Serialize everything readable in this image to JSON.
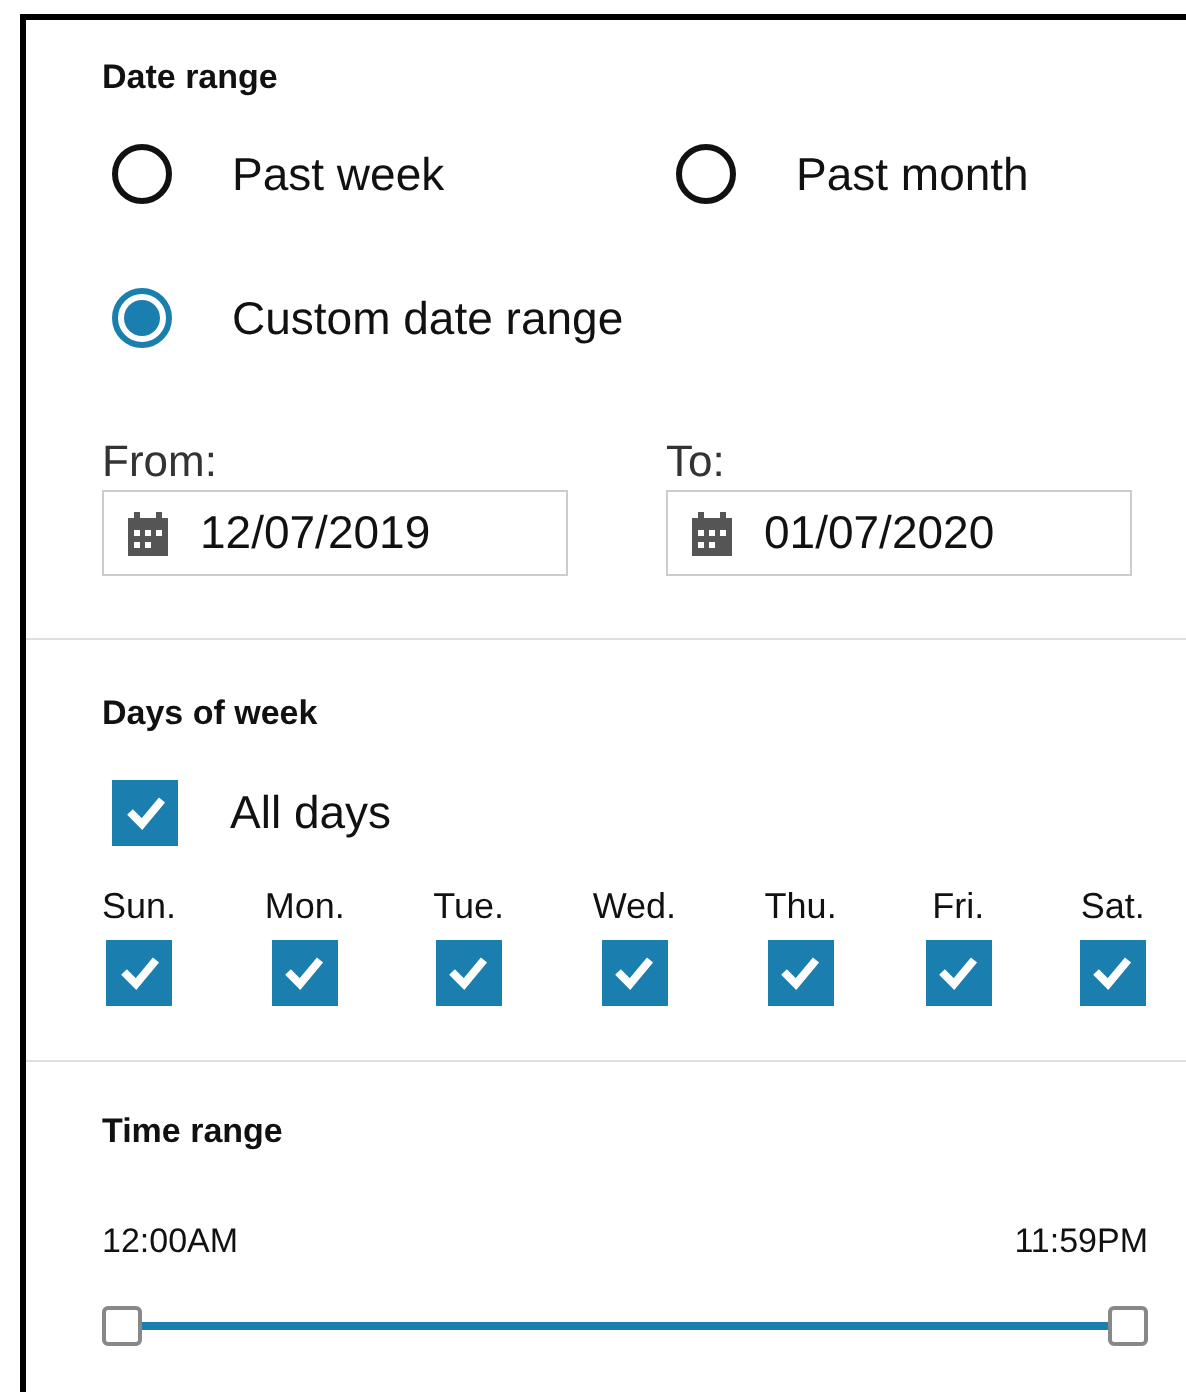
{
  "date_range": {
    "heading": "Date range",
    "options": [
      {
        "label": "Past week",
        "selected": false
      },
      {
        "label": "Past month",
        "selected": false
      },
      {
        "label": "Custom date range",
        "selected": true
      }
    ],
    "from": {
      "label": "From:",
      "value": "12/07/2019"
    },
    "to": {
      "label": "To:",
      "value": "01/07/2020"
    }
  },
  "days_of_week": {
    "heading": "Days of week",
    "all_days": {
      "label": "All days",
      "checked": true
    },
    "days": [
      {
        "label": "Sun.",
        "checked": true
      },
      {
        "label": "Mon.",
        "checked": true
      },
      {
        "label": "Tue.",
        "checked": true
      },
      {
        "label": "Wed.",
        "checked": true
      },
      {
        "label": "Thu.",
        "checked": true
      },
      {
        "label": "Fri.",
        "checked": true
      },
      {
        "label": "Sat.",
        "checked": true
      }
    ]
  },
  "time_range": {
    "heading": "Time range",
    "start": {
      "label": "12:00AM",
      "level": 0
    },
    "end": {
      "label": "11:59PM",
      "level": 1
    }
  }
}
